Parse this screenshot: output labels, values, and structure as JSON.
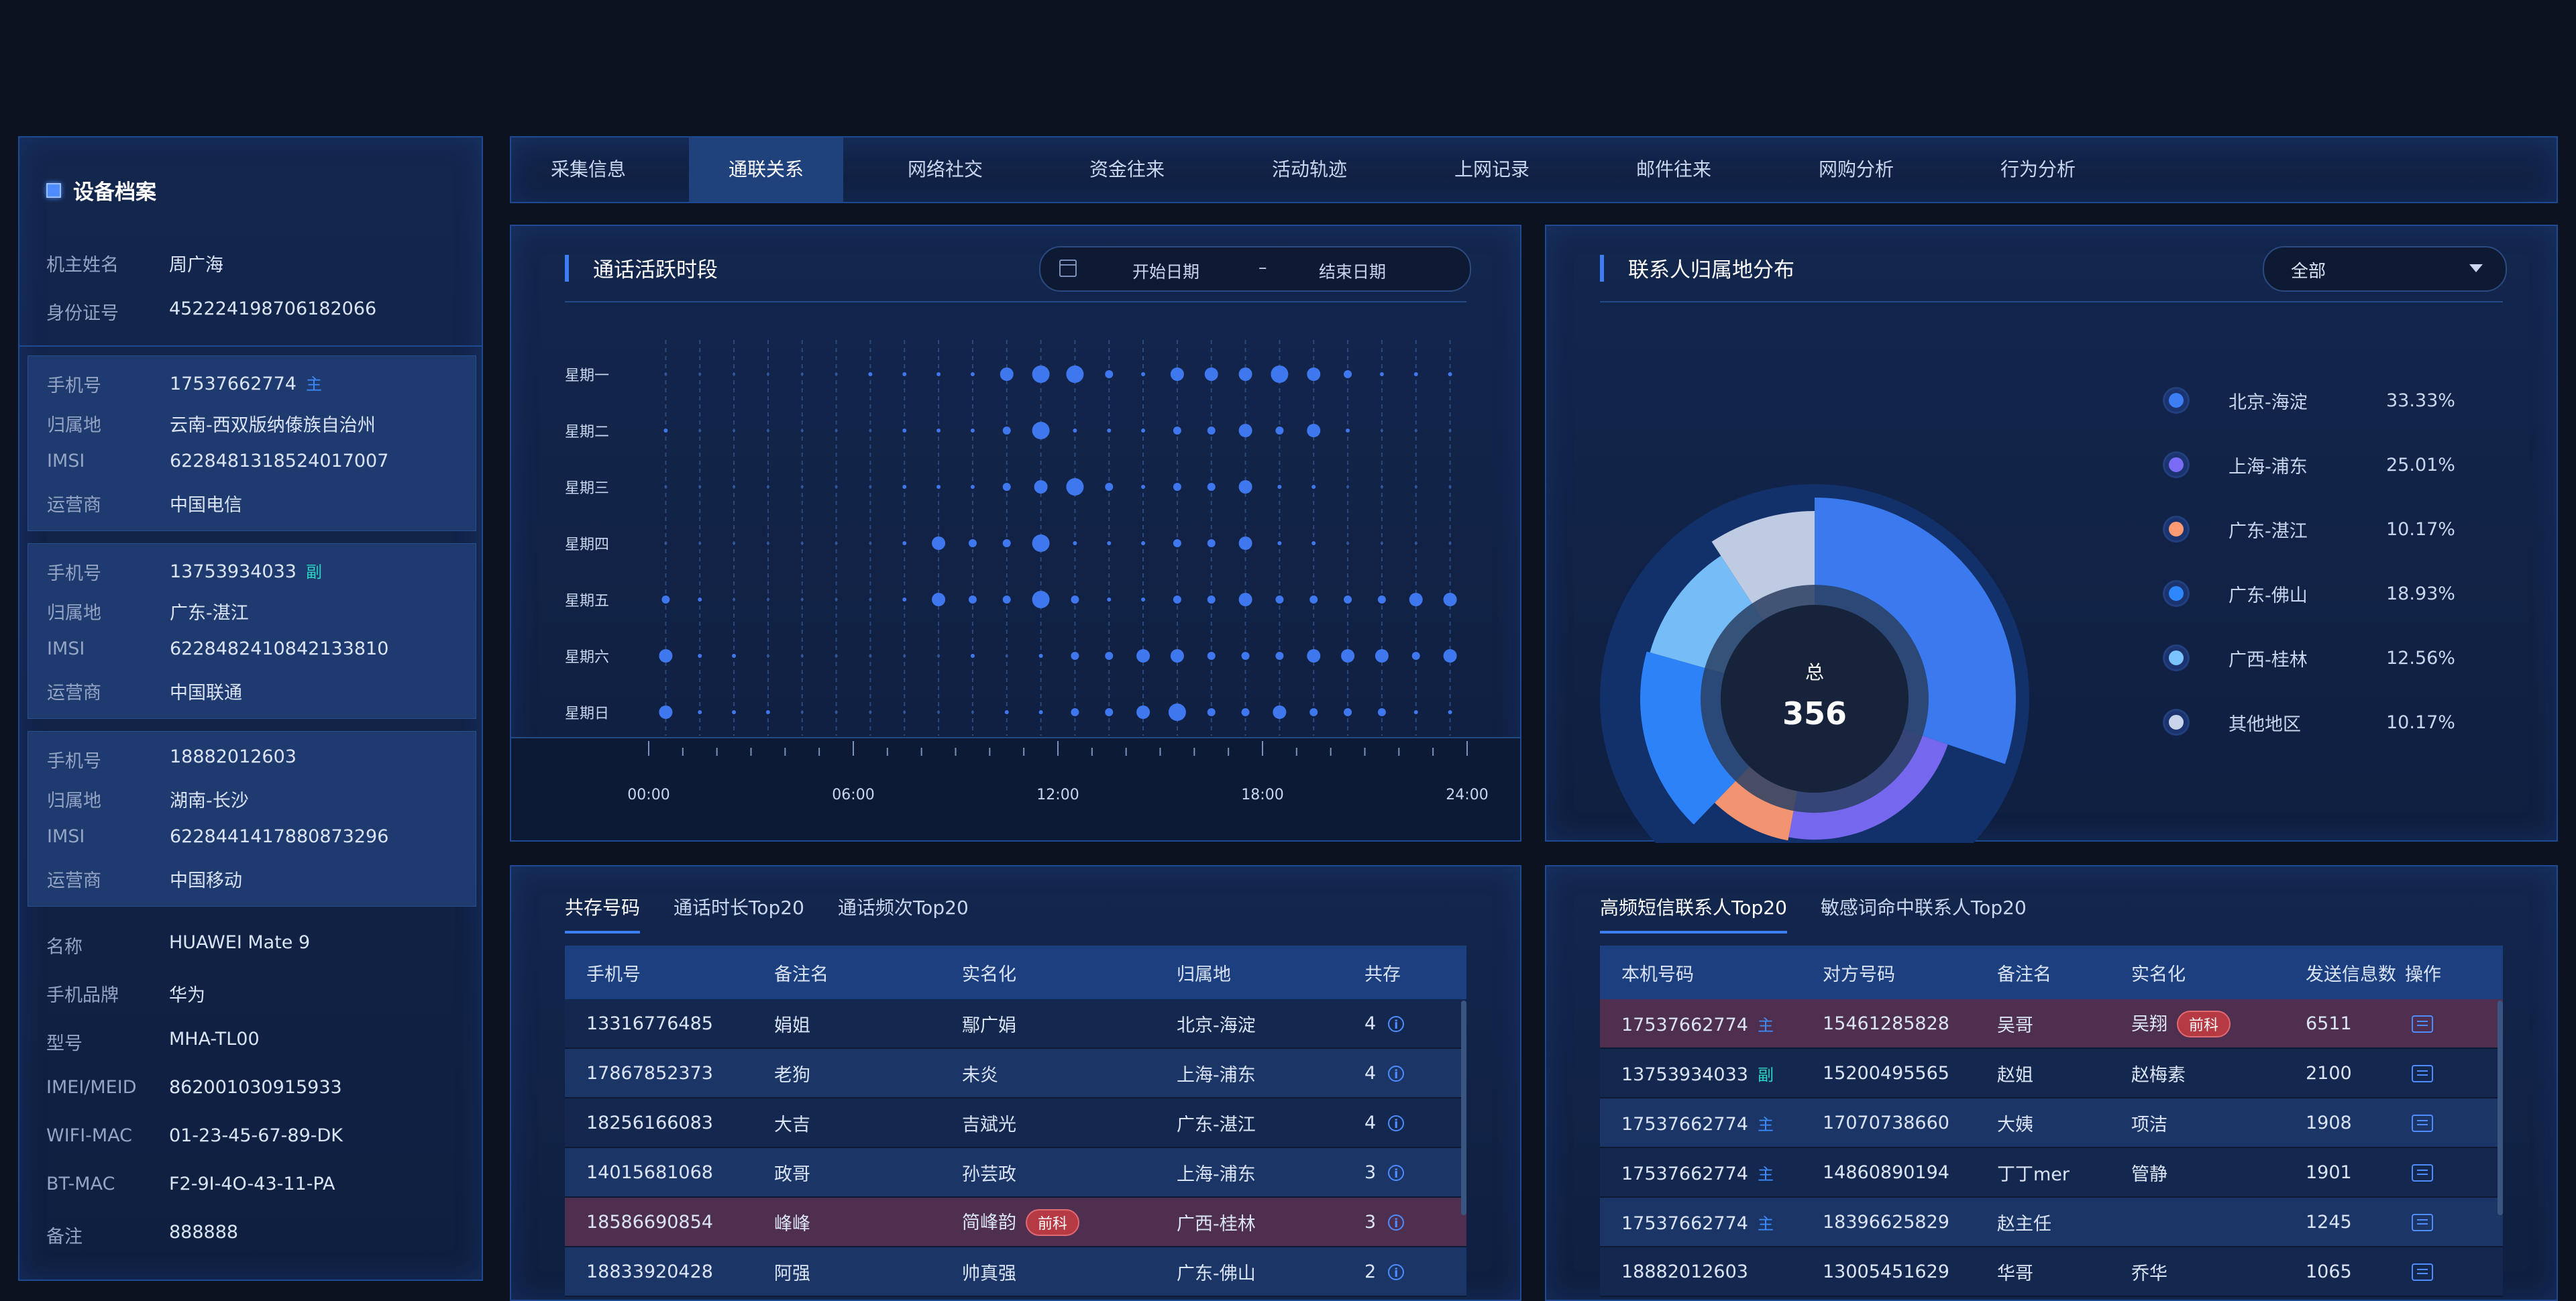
{
  "profile": {
    "title": "设备档案",
    "owner": [
      {
        "k": "机主姓名",
        "v": "周广海"
      },
      {
        "k": "身份证号",
        "v": "452224198706182066"
      }
    ],
    "sims": [
      {
        "phone_label": "手机号",
        "phone": "17537662774",
        "tag": "主",
        "loc_label": "归属地",
        "loc": "云南-西双版纳傣族自治州",
        "imsi_label": "IMSI",
        "imsi": "6228481318524017007",
        "op_label": "运营商",
        "op": "中国电信"
      },
      {
        "phone_label": "手机号",
        "phone": "13753934033",
        "tag": "副",
        "loc_label": "归属地",
        "loc": "广东-湛江",
        "imsi_label": "IMSI",
        "imsi": "6228482410842133810",
        "op_label": "运营商",
        "op": "中国联通"
      },
      {
        "phone_label": "手机号",
        "phone": "18882012603",
        "tag": "",
        "loc_label": "归属地",
        "loc": "湖南-长沙",
        "imsi_label": "IMSI",
        "imsi": "6228441417880873296",
        "op_label": "运营商",
        "op": "中国移动"
      }
    ],
    "device": [
      {
        "k": "名称",
        "v": "HUAWEI Mate 9"
      },
      {
        "k": "手机品牌",
        "v": "华为"
      },
      {
        "k": "型号",
        "v": "MHA-TL00"
      },
      {
        "k": "IMEI/MEID",
        "v": "862001030915933"
      },
      {
        "k": "WIFI-MAC",
        "v": "01-23-45-67-89-DK"
      },
      {
        "k": "BT-MAC",
        "v": "F2-9I-4O-43-11-PA"
      },
      {
        "k": "备注",
        "v": "888888"
      }
    ]
  },
  "tabs": [
    "采集信息",
    "通联关系",
    "网络社交",
    "资金往来",
    "活动轨迹",
    "上网记录",
    "邮件往来",
    "网购分析",
    "行为分析"
  ],
  "active_tab": 1,
  "activity": {
    "title": "通话活跃时段",
    "start_placeholder": "开始日期",
    "separator": "–",
    "end_placeholder": "结束日期"
  },
  "chart_data": [
    {
      "type": "scatter",
      "title": "通话活跃时段",
      "y_categories": [
        "星期一",
        "星期二",
        "星期三",
        "星期四",
        "星期五",
        "星期六",
        "星期日"
      ],
      "x_ticks": [
        "00:00",
        "06:00",
        "12:00",
        "18:00",
        "24:00"
      ],
      "x_range": [
        0,
        24
      ],
      "hours": [
        0,
        1,
        2,
        3,
        4,
        5,
        6,
        7,
        8,
        9,
        10,
        11,
        12,
        13,
        14,
        15,
        16,
        17,
        18,
        19,
        20,
        21,
        22,
        23
      ],
      "intensity": [
        [
          0,
          0,
          0,
          0,
          0,
          0,
          1,
          1,
          1,
          1,
          3,
          4,
          4,
          2,
          1,
          3,
          3,
          3,
          4,
          3,
          2,
          1,
          1,
          1
        ],
        [
          1,
          0,
          0,
          0,
          0,
          0,
          0,
          1,
          1,
          1,
          2,
          4,
          1,
          1,
          1,
          2,
          2,
          3,
          2,
          3,
          1,
          0,
          0,
          0
        ],
        [
          0,
          0,
          0,
          0,
          0,
          0,
          0,
          1,
          1,
          1,
          2,
          3,
          4,
          2,
          1,
          2,
          2,
          3,
          1,
          1,
          0,
          0,
          0,
          0
        ],
        [
          0,
          0,
          0,
          0,
          0,
          0,
          0,
          1,
          3,
          2,
          2,
          4,
          1,
          1,
          1,
          2,
          2,
          3,
          1,
          1,
          0,
          0,
          0,
          0
        ],
        [
          2,
          1,
          0,
          0,
          0,
          0,
          0,
          1,
          3,
          2,
          2,
          4,
          2,
          1,
          1,
          2,
          2,
          3,
          2,
          2,
          2,
          2,
          3,
          3
        ],
        [
          3,
          1,
          1,
          0,
          0,
          0,
          0,
          0,
          0,
          1,
          0,
          1,
          2,
          2,
          3,
          3,
          2,
          2,
          2,
          3,
          3,
          3,
          2,
          3
        ],
        [
          3,
          1,
          1,
          1,
          0,
          0,
          0,
          0,
          0,
          0,
          1,
          1,
          2,
          2,
          3,
          4,
          2,
          2,
          3,
          2,
          2,
          2,
          1,
          1
        ]
      ]
    },
    {
      "type": "pie",
      "title": "联系人归属地分布",
      "center_label": "总",
      "total": "356",
      "slices": [
        {
          "name": "北京-海淀",
          "pct": "33.33%",
          "value": 33.33,
          "color": "#3d7ef5"
        },
        {
          "name": "上海-浦东",
          "pct": "25.01%",
          "value": 25.01,
          "color": "#7b6cf6"
        },
        {
          "name": "广东-湛江",
          "pct": "10.17%",
          "value": 10.17,
          "color": "#ff9a72"
        },
        {
          "name": "广东-佛山",
          "pct": "18.93%",
          "value": 18.93,
          "color": "#2f87ff"
        },
        {
          "name": "广西-桂林",
          "pct": "12.56%",
          "value": 12.56,
          "color": "#7cc4ff"
        },
        {
          "name": "其他地区",
          "pct": "10.17%",
          "value": 10.17,
          "color": "#c9d4ea"
        }
      ]
    }
  ],
  "location": {
    "title": "联系人归属地分布",
    "select_value": "全部"
  },
  "coexist": {
    "tabs": [
      "共存号码",
      "通话时长Top20",
      "通话频次Top20"
    ],
    "headers": [
      "手机号",
      "备注名",
      "实名化",
      "归属地",
      "共存"
    ],
    "rows": [
      {
        "phone": "13316776485",
        "alias": "娟姐",
        "real": "鄢广娟",
        "badge": "",
        "loc": "北京-海淀",
        "count": "4"
      },
      {
        "phone": "17867852373",
        "alias": "老狗",
        "real": "未炎",
        "badge": "",
        "loc": "上海-浦东",
        "count": "4"
      },
      {
        "phone": "18256166083",
        "alias": "大吉",
        "real": "吉斌光",
        "badge": "",
        "loc": "广东-湛江",
        "count": "4"
      },
      {
        "phone": "14015681068",
        "alias": "政哥",
        "real": "孙芸政",
        "badge": "",
        "loc": "上海-浦东",
        "count": "3"
      },
      {
        "phone": "18586690854",
        "alias": "峰峰",
        "real": "简峰韵",
        "badge": "前科",
        "loc": "广西-桂林",
        "count": "3"
      },
      {
        "phone": "18833920428",
        "alias": "阿强",
        "real": "帅真强",
        "badge": "",
        "loc": "广东-佛山",
        "count": "2"
      }
    ]
  },
  "sms": {
    "tabs": [
      "高频短信联系人Top20",
      "敏感词命中联系人Top20"
    ],
    "headers": [
      "本机号码",
      "对方号码",
      "备注名",
      "实名化",
      "发送信息数",
      "操作"
    ],
    "rows": [
      {
        "local": "17537662774",
        "tag": "主",
        "peer": "15461285828",
        "alias": "吴哥",
        "real": "吴翔",
        "badge": "前科",
        "count": "6511"
      },
      {
        "local": "13753934033",
        "tag": "副",
        "peer": "15200495565",
        "alias": "赵姐",
        "real": "赵梅素",
        "badge": "",
        "count": "2100"
      },
      {
        "local": "17537662774",
        "tag": "主",
        "peer": "17070738660",
        "alias": "大姨",
        "real": "项洁",
        "badge": "",
        "count": "1908"
      },
      {
        "local": "17537662774",
        "tag": "主",
        "peer": "14860890194",
        "alias": "丁丁mer",
        "real": "管静",
        "badge": "",
        "count": "1901"
      },
      {
        "local": "17537662774",
        "tag": "主",
        "peer": "18396625829",
        "alias": "赵主任",
        "real": "",
        "badge": "",
        "count": "1245"
      },
      {
        "local": "18882012603",
        "tag": "",
        "peer": "13005451629",
        "alias": "华哥",
        "real": "乔华",
        "badge": "",
        "count": "1065"
      }
    ]
  }
}
